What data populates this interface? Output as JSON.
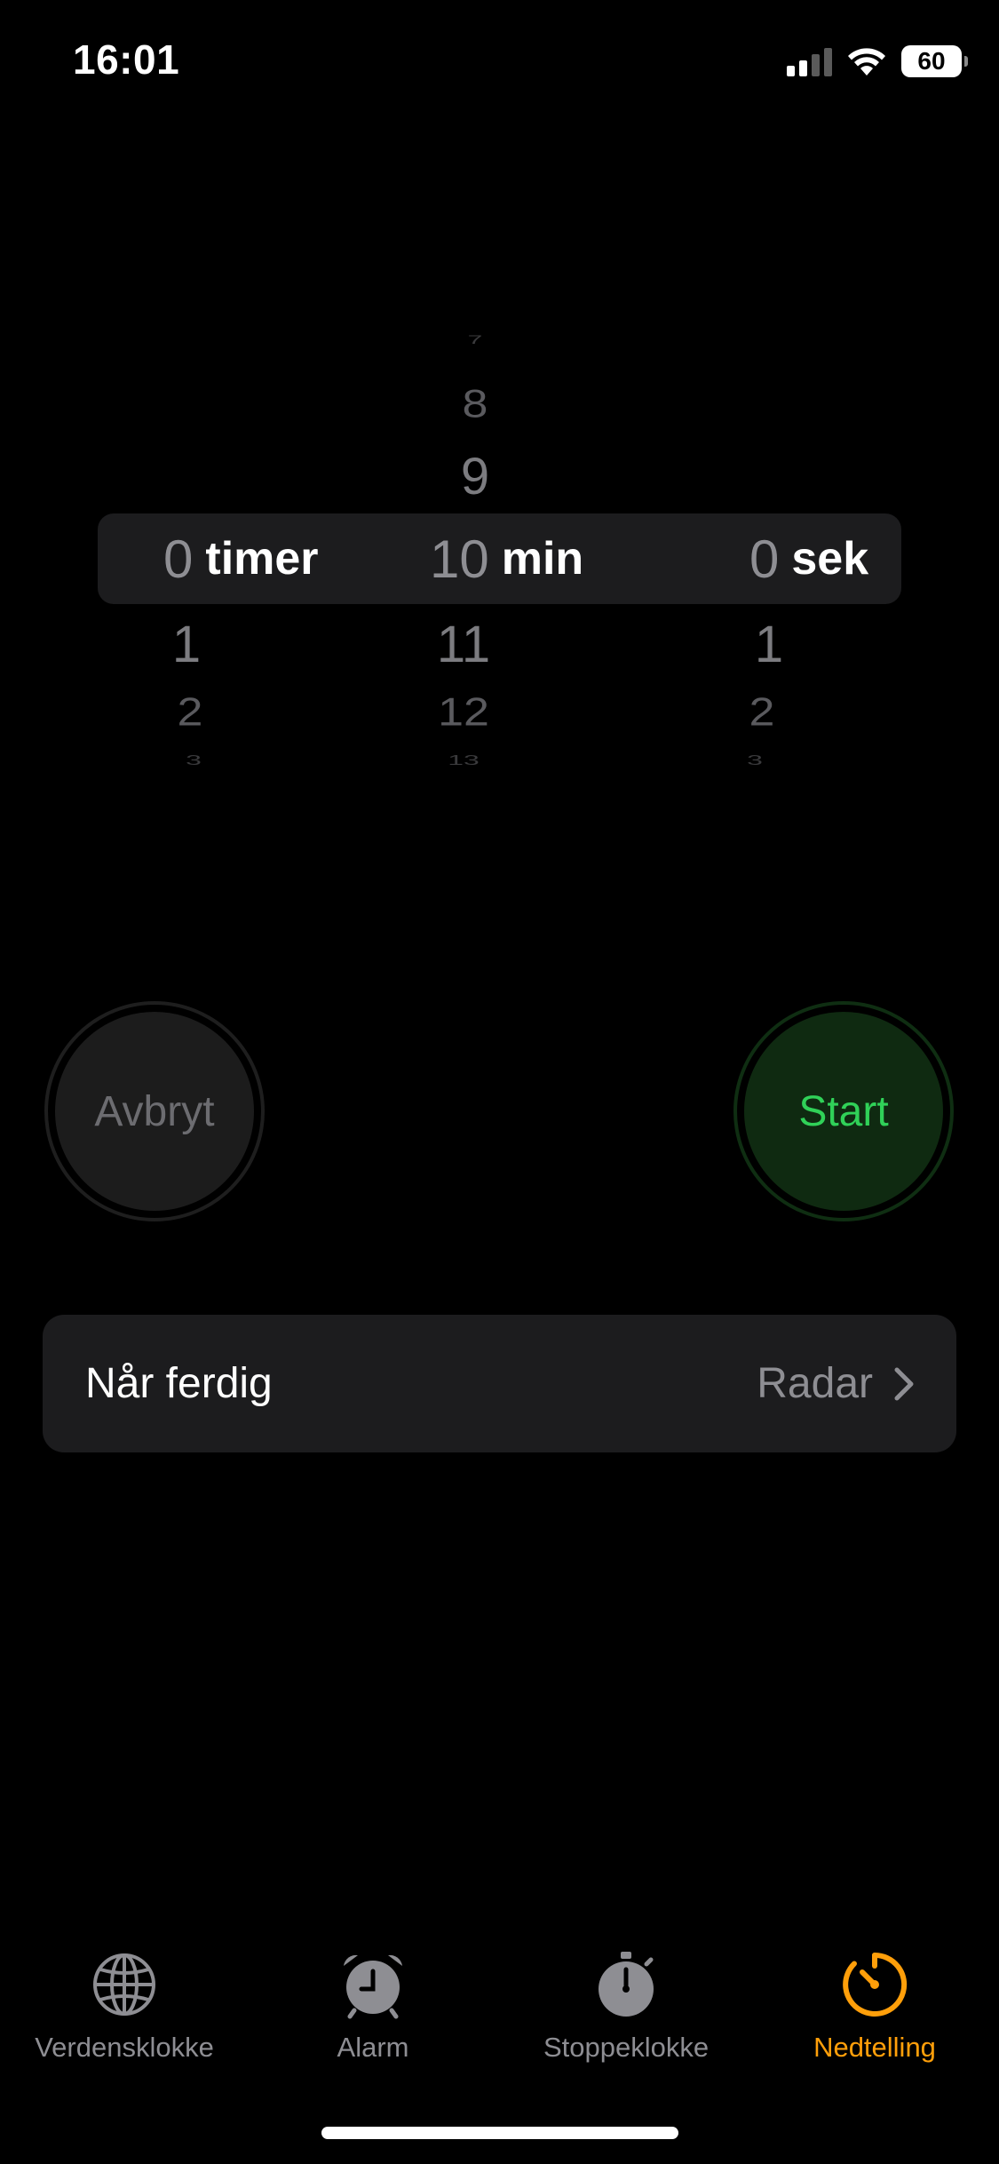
{
  "status_bar": {
    "time": "16:01",
    "battery": "60",
    "icons": [
      "cellular-signal-icon",
      "wifi-icon",
      "battery-icon"
    ]
  },
  "picker": {
    "hours": {
      "above": [
        "",
        ""
      ],
      "selected": "0",
      "unit": "timer",
      "below": [
        "1",
        "2",
        "3"
      ]
    },
    "minutes": {
      "above": [
        "7",
        "8",
        "9"
      ],
      "selected": "10",
      "unit": "min",
      "below": [
        "11",
        "12",
        "13"
      ]
    },
    "seconds": {
      "above": [
        "",
        ""
      ],
      "selected": "0",
      "unit": "sek",
      "below": [
        "1",
        "2",
        "3"
      ]
    }
  },
  "buttons": {
    "cancel_label": "Avbryt",
    "start_label": "Start"
  },
  "when_done": {
    "label": "Når ferdig",
    "value": "Radar"
  },
  "tabs": [
    {
      "label": "Verdensklokke",
      "icon": "globe-icon",
      "active": false
    },
    {
      "label": "Alarm",
      "icon": "alarm-clock-icon",
      "active": false
    },
    {
      "label": "Stoppeklokke",
      "icon": "stopwatch-icon",
      "active": false
    },
    {
      "label": "Nedtelling",
      "icon": "timer-icon",
      "active": true
    }
  ],
  "colors": {
    "accent_active_tab": "#ff9f0a",
    "start_green": "#30d158",
    "inactive_gray": "#8e8e93"
  }
}
